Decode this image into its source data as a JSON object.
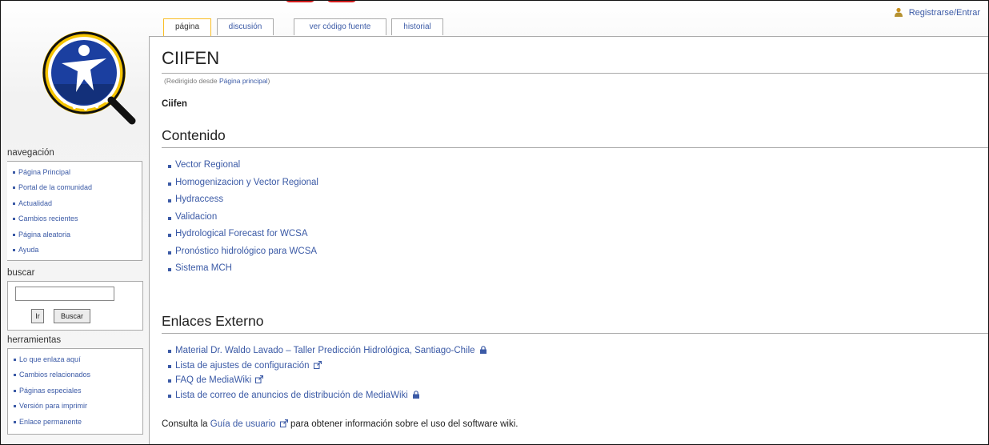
{
  "user": {
    "login_label": "Registrarse/Entrar",
    "icon": "user-icon"
  },
  "tabs": [
    {
      "label": "página",
      "selected": true
    },
    {
      "label": "discusión",
      "selected": false
    },
    {
      "label": "ver código fuente",
      "selected": false
    },
    {
      "label": "historial",
      "selected": false
    }
  ],
  "page": {
    "title": "CIIFEN",
    "redirect_prefix": "(Redirigido desde",
    "redirect_link": "Página principal",
    "redirect_suffix": ")",
    "intro": "Ciifen"
  },
  "contenido": {
    "heading": "Contenido",
    "links": [
      "Vector Regional",
      "Homogenizacion y Vector Regional",
      "Hydraccess",
      "Validacion",
      "Hydrological Forecast for WCSA",
      "Pronóstico hidrológico para WCSA",
      "Sistema MCH"
    ]
  },
  "enlaces": {
    "heading": "Enlaces Externo",
    "links": [
      {
        "text": "Material Dr. Waldo Lavado – Taller Predicción Hidrológica, Santiago-Chile",
        "icon": "lock-icon"
      },
      {
        "text": "Lista de ajustes de configuración",
        "icon": "external-link-icon"
      },
      {
        "text": "FAQ de MediaWiki",
        "icon": "external-link-icon"
      },
      {
        "text": "Lista de correo de anuncios de distribución de MediaWiki",
        "icon": "lock-icon"
      }
    ]
  },
  "footer_note": {
    "prefix": "Consulta la",
    "link": "Guía de usuario",
    "suffix": "para obtener información sobre el uso del software wiki."
  },
  "sidebar": {
    "navigation": {
      "title": "navegación",
      "items": [
        "Página Principal",
        "Portal de la comunidad",
        "Actualidad",
        "Cambios recientes",
        "Página aleatoria",
        "Ayuda"
      ]
    },
    "search": {
      "title": "buscar",
      "value": "",
      "go_label": "Ir",
      "search_label": "Buscar"
    },
    "tools": {
      "title": "herramientas",
      "items": [
        "Lo que enlaza aquí",
        "Cambios relacionados",
        "Páginas especiales",
        "Versión para imprimir",
        "Enlace permanente"
      ]
    }
  },
  "colors": {
    "link": "#3b5aa6",
    "tab_selected_border": "#fabd23",
    "logo_blue": "#1b3fa0",
    "logo_yellow": "#f5c400",
    "banner_red": "#d21e1e"
  }
}
